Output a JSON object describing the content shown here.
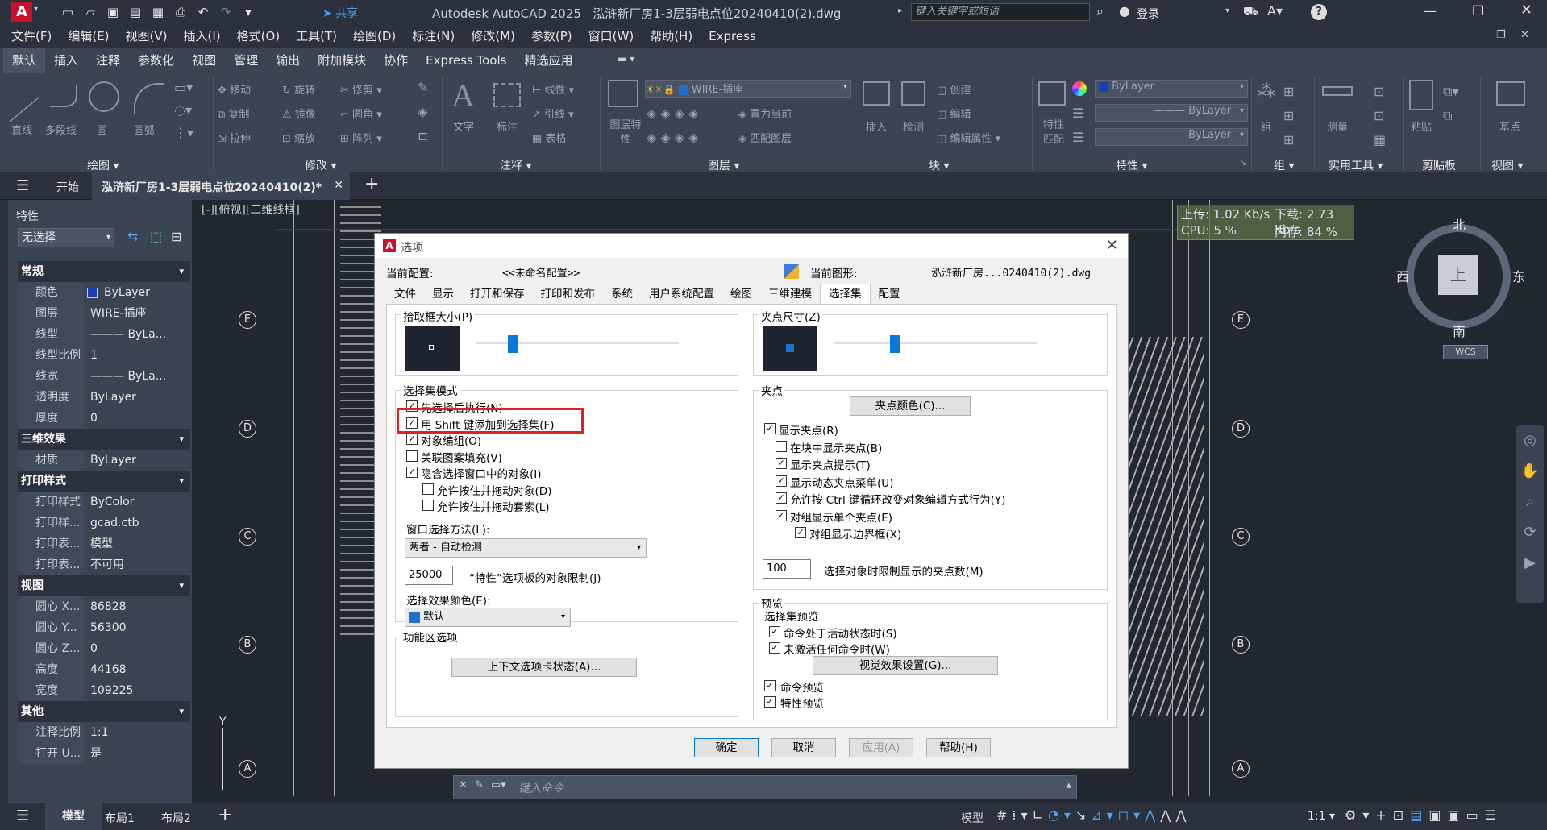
{
  "app": {
    "title": "Autodesk AutoCAD 2025",
    "file": "泓浒新厂房1-3层弱电点位20240410(2).dwg",
    "search_placeholder": "键入关键字或短语",
    "login": "登录",
    "share": "共享"
  },
  "menu": [
    "文件(F)",
    "编辑(E)",
    "视图(V)",
    "插入(I)",
    "格式(O)",
    "工具(T)",
    "绘图(D)",
    "标注(N)",
    "修改(M)",
    "参数(P)",
    "窗口(W)",
    "帮助(H)",
    "Express"
  ],
  "ribbon_tabs": [
    "默认",
    "插入",
    "注释",
    "参数化",
    "视图",
    "管理",
    "输出",
    "附加模块",
    "协作",
    "Express Tools",
    "精选应用"
  ],
  "ribbon": {
    "draw": {
      "title": "绘图",
      "tools": [
        "直线",
        "多段线",
        "圆",
        "圆弧"
      ]
    },
    "modify": {
      "title": "修改",
      "tools": [
        "移动",
        "旋转",
        "修剪",
        "复制",
        "镜像",
        "圆角",
        "拉伸",
        "缩放",
        "阵列"
      ]
    },
    "annotation": {
      "title": "注释",
      "tools": [
        "文字",
        "标注",
        "线性",
        "引线",
        "表格"
      ]
    },
    "layers": {
      "title": "图层",
      "layer": "WIRE-插座",
      "tools": [
        "图层特性",
        "置为当前",
        "匹配图层"
      ]
    },
    "block": {
      "title": "块",
      "tools": [
        "插入",
        "检测",
        "创建",
        "编辑",
        "编辑属性"
      ]
    },
    "properties": {
      "title": "特性",
      "tools": [
        "特性匹配"
      ],
      "color": "ByLayer",
      "linetype": "ByLayer",
      "lineweight": "ByLayer"
    },
    "groups": {
      "title": "组",
      "tool": "组"
    },
    "utilities": {
      "title": "实用工具",
      "tool": "测量"
    },
    "clipboard": {
      "title": "剪贴板",
      "tool": "粘贴"
    },
    "view": {
      "title": "视图",
      "tool": "基点"
    }
  },
  "doc_tabs": {
    "start": "开始",
    "active": "泓浒新厂房1-3层弱电点位20240410(2)*"
  },
  "props": {
    "title": "特性",
    "selection": "无选择",
    "sections": [
      {
        "name": "常规",
        "rows": [
          [
            "颜色",
            "ByLayer"
          ],
          [
            "图层",
            "WIRE-插座"
          ],
          [
            "线型",
            "——— ByLa..."
          ],
          [
            "线型比例",
            "1"
          ],
          [
            "线宽",
            "——— ByLa..."
          ],
          [
            "透明度",
            "ByLayer"
          ],
          [
            "厚度",
            "0"
          ]
        ]
      },
      {
        "name": "三维效果",
        "rows": [
          [
            "材质",
            "ByLayer"
          ]
        ]
      },
      {
        "name": "打印样式",
        "rows": [
          [
            "打印样式",
            "ByColor"
          ],
          [
            "打印样...",
            "gcad.ctb"
          ],
          [
            "打印表...",
            "模型"
          ],
          [
            "打印表...",
            "不可用"
          ]
        ]
      },
      {
        "name": "视图",
        "rows": [
          [
            "圆心 X...",
            "86828"
          ],
          [
            "圆心 Y...",
            "56300"
          ],
          [
            "圆心 Z...",
            "0"
          ],
          [
            "高度",
            "44168"
          ],
          [
            "宽度",
            "109225"
          ]
        ]
      },
      {
        "name": "其他",
        "rows": [
          [
            "注释比例",
            "1:1"
          ],
          [
            "打开 U...",
            "是"
          ]
        ]
      }
    ]
  },
  "canvas": {
    "viewport_label": "[-][俯视][二维线框]",
    "axis_labels": [
      "E",
      "D",
      "C",
      "B",
      "A"
    ],
    "compass": {
      "n": "北",
      "s": "南",
      "e": "东",
      "w": "西",
      "top": "上",
      "wcs": "WCS"
    },
    "net": {
      "up": "上传: 1.02 Kb/s",
      "down": "下载: 2.73 Kb/s",
      "cpu": "CPU: 5 %",
      "mem": "内存: 84 %"
    },
    "cmd_placeholder": "键入命令",
    "y_label": "Y"
  },
  "dialog": {
    "title": "选项",
    "current_profile_label": "当前配置:",
    "current_profile": "<<未命名配置>>",
    "current_drawing_label": "当前图形:",
    "current_drawing": "泓浒新厂房...0240410(2).dwg",
    "tabs": [
      "文件",
      "显示",
      "打开和保存",
      "打印和发布",
      "系统",
      "用户系统配置",
      "绘图",
      "三维建模",
      "选择集",
      "配置"
    ],
    "active_tab": "选择集",
    "pickbox_label": "拾取框大小(P)",
    "grip_size_label": "夹点尺寸(Z)",
    "sel_modes_label": "选择集模式",
    "sel_modes": [
      {
        "label": "先选择后执行(N)",
        "checked": true
      },
      {
        "label": "用 Shift 键添加到选择集(F)",
        "checked": true
      },
      {
        "label": "对象编组(O)",
        "checked": true
      },
      {
        "label": "关联图案填充(V)",
        "checked": false
      },
      {
        "label": "隐含选择窗口中的对象(I)",
        "checked": true
      },
      {
        "label": "允许按住并拖动对象(D)",
        "checked": false
      },
      {
        "label": "允许按住并拖动套索(L)",
        "checked": false
      }
    ],
    "window_method_label": "窗口选择方法(L):",
    "window_method": "两者 - 自动检测",
    "limit_value": "25000",
    "limit_label": "“特性”选项板的对象限制(J)",
    "effect_color_label": "选择效果颜色(E):",
    "effect_color": "默认",
    "ribbon_opts_label": "功能区选项",
    "ribbon_btn": "上下文选项卡状态(A)...",
    "grips_label": "夹点",
    "grip_color_btn": "夹点颜色(C)...",
    "grip_opts": [
      {
        "label": "显示夹点(R)",
        "checked": true
      },
      {
        "label": "在块中显示夹点(B)",
        "checked": false
      },
      {
        "label": "显示夹点提示(T)",
        "checked": true
      },
      {
        "label": "显示动态夹点菜单(U)",
        "checked": true
      },
      {
        "label": "允许按 Ctrl 键循环改变对象编辑方式行为(Y)",
        "checked": true
      },
      {
        "label": "对组显示单个夹点(E)",
        "checked": true
      },
      {
        "label": "对组显示边界框(X)",
        "checked": true
      }
    ],
    "grip_limit_value": "100",
    "grip_limit_label": "选择对象时限制显示的夹点数(M)",
    "preview_label": "预览",
    "sel_preview_label": "选择集预览",
    "sel_preview": [
      {
        "label": "命令处于活动状态时(S)",
        "checked": true
      },
      {
        "label": "未激活任何命令时(W)",
        "checked": true
      }
    ],
    "visual_btn": "视觉效果设置(G)...",
    "cmd_preview": {
      "label": "命令预览",
      "checked": true
    },
    "prop_preview": {
      "label": "特性预览",
      "checked": true
    },
    "ok": "确定",
    "cancel": "取消",
    "apply": "应用(A)",
    "help": "帮助(H)"
  },
  "status": {
    "tabs": [
      "模型",
      "布局1",
      "布局2"
    ],
    "model": "模型",
    "scale": "1:1"
  },
  "colors": {
    "accent": "#1f6fd1",
    "highlight": "#e01f1f",
    "bg": "#212830",
    "panel": "#3b4453"
  }
}
